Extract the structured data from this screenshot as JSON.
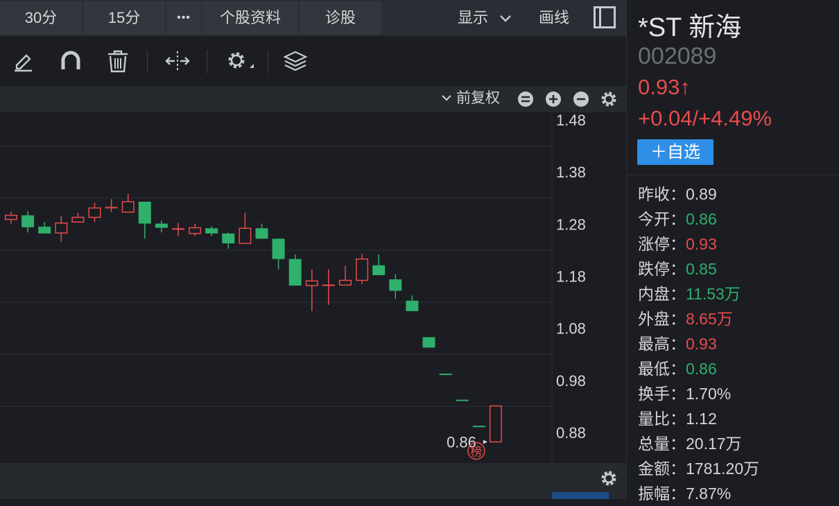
{
  "tabs": {
    "t30": "30分",
    "t15": "15分",
    "more": "•••",
    "profile": "个股资料",
    "diagnose": "诊股",
    "display": "显示",
    "draw": "画线"
  },
  "chart_toolbar": {
    "adjust": "前复权"
  },
  "stock": {
    "name": "*ST 新海",
    "code": "002089",
    "price": "0.93↑",
    "change": "+0.04/+4.49%",
    "watch_label": "＋自选"
  },
  "stats": [
    {
      "label": "昨收：",
      "value": "0.89",
      "tone": "neutral"
    },
    {
      "label": "今开：",
      "value": "0.86",
      "tone": "green"
    },
    {
      "label": "涨停：",
      "value": "0.93",
      "tone": "red"
    },
    {
      "label": "跌停：",
      "value": "0.85",
      "tone": "green"
    },
    {
      "label": "内盘：",
      "value": "11.53万",
      "tone": "green"
    },
    {
      "label": "外盘：",
      "value": "8.65万",
      "tone": "red"
    },
    {
      "label": "最高：",
      "value": "0.93",
      "tone": "red"
    },
    {
      "label": "最低：",
      "value": "0.86",
      "tone": "green"
    },
    {
      "label": "换手：",
      "value": "1.70%",
      "tone": "neutral"
    },
    {
      "label": "量比：",
      "value": "1.12",
      "tone": "neutral"
    },
    {
      "label": "总量：",
      "value": "20.17万",
      "tone": "neutral"
    },
    {
      "label": "金额：",
      "value": "1781.20万",
      "tone": "neutral"
    },
    {
      "label": "振幅：",
      "value": "7.87%",
      "tone": "neutral"
    }
  ],
  "colors": {
    "up": "#e84b4b",
    "down": "#2fb06c",
    "accent": "#2f8ee6"
  },
  "chart_data": {
    "type": "candlestick",
    "y_ticks": [
      "1.48",
      "1.38",
      "1.28",
      "1.18",
      "1.08",
      "0.98",
      "0.88"
    ],
    "ylim": [
      0.84,
      1.5
    ],
    "low_marker": "0.86",
    "low_badge": "榜",
    "candles": [
      {
        "o": 1.289,
        "c": 1.297,
        "h": 1.304,
        "l": 1.281
      },
      {
        "o": 1.297,
        "c": 1.274,
        "h": 1.305,
        "l": 1.264
      },
      {
        "o": 1.275,
        "c": 1.262,
        "h": 1.284,
        "l": 1.262
      },
      {
        "o": 1.263,
        "c": 1.282,
        "h": 1.296,
        "l": 1.246
      },
      {
        "o": 1.284,
        "c": 1.293,
        "h": 1.302,
        "l": 1.284
      },
      {
        "o": 1.293,
        "c": 1.311,
        "h": 1.321,
        "l": 1.284
      },
      {
        "o": 1.313,
        "c": 1.313,
        "h": 1.328,
        "l": 1.303
      },
      {
        "o": 1.303,
        "c": 1.323,
        "h": 1.338,
        "l": 1.303
      },
      {
        "o": 1.323,
        "c": 1.281,
        "h": 1.323,
        "l": 1.252
      },
      {
        "o": 1.281,
        "c": 1.273,
        "h": 1.287,
        "l": 1.264
      },
      {
        "o": 1.272,
        "c": 1.272,
        "h": 1.282,
        "l": 1.257
      },
      {
        "o": 1.262,
        "c": 1.273,
        "h": 1.281,
        "l": 1.257
      },
      {
        "o": 1.272,
        "c": 1.262,
        "h": 1.276,
        "l": 1.257
      },
      {
        "o": 1.262,
        "c": 1.243,
        "h": 1.264,
        "l": 1.233
      },
      {
        "o": 1.243,
        "c": 1.272,
        "h": 1.302,
        "l": 1.243
      },
      {
        "o": 1.272,
        "c": 1.252,
        "h": 1.281,
        "l": 1.252
      },
      {
        "o": 1.252,
        "c": 1.213,
        "h": 1.252,
        "l": 1.193
      },
      {
        "o": 1.213,
        "c": 1.162,
        "h": 1.222,
        "l": 1.162
      },
      {
        "o": 1.162,
        "c": 1.171,
        "h": 1.193,
        "l": 1.113
      },
      {
        "o": 1.164,
        "c": 1.164,
        "h": 1.193,
        "l": 1.125
      },
      {
        "o": 1.163,
        "c": 1.172,
        "h": 1.2,
        "l": 1.163
      },
      {
        "o": 1.172,
        "c": 1.213,
        "h": 1.223,
        "l": 1.165
      },
      {
        "o": 1.201,
        "c": 1.182,
        "h": 1.222,
        "l": 1.182
      },
      {
        "o": 1.174,
        "c": 1.152,
        "h": 1.184,
        "l": 1.137
      },
      {
        "o": 1.133,
        "c": 1.113,
        "h": 1.143,
        "l": 1.113
      },
      {
        "o": 1.063,
        "c": 1.043,
        "h": 1.063,
        "l": 1.043
      },
      {
        "o": 0.993,
        "c": 0.993,
        "h": 0.993,
        "l": 0.993
      },
      {
        "o": 0.943,
        "c": 0.943,
        "h": 0.943,
        "l": 0.943
      },
      {
        "o": 0.893,
        "c": 0.893,
        "h": 0.893,
        "l": 0.893
      },
      {
        "o": 0.862,
        "c": 0.931,
        "h": 0.931,
        "l": 0.862
      }
    ]
  }
}
